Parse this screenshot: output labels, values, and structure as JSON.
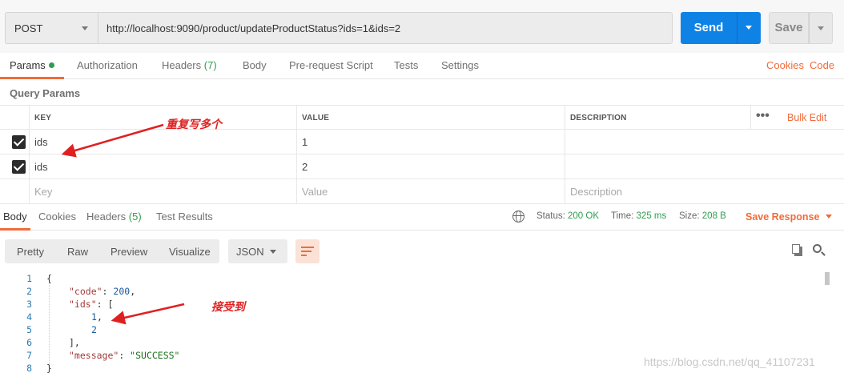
{
  "request": {
    "method": "POST",
    "url": "http://localhost:9090/product/updateProductStatus?ids=1&ids=2",
    "send_label": "Send",
    "save_label": "Save"
  },
  "request_tabs": {
    "params": "Params",
    "authorization": "Authorization",
    "headers": "Headers",
    "headers_count": "(7)",
    "body": "Body",
    "prerequest": "Pre-request Script",
    "tests": "Tests",
    "settings": "Settings",
    "cookies": "Cookies",
    "code": "Code"
  },
  "query_params": {
    "title": "Query Params",
    "columns": {
      "key": "KEY",
      "value": "VALUE",
      "description": "DESCRIPTION"
    },
    "bulk_edit": "Bulk Edit",
    "rows": [
      {
        "key": "ids",
        "value": "1"
      },
      {
        "key": "ids",
        "value": "2"
      }
    ],
    "placeholders": {
      "key": "Key",
      "value": "Value",
      "description": "Description"
    }
  },
  "response_tabs": {
    "body": "Body",
    "cookies": "Cookies",
    "headers": "Headers",
    "headers_count": "(5)",
    "test_results": "Test Results"
  },
  "response_status": {
    "status_label": "Status:",
    "status_value": "200 OK",
    "time_label": "Time:",
    "time_value": "325 ms",
    "size_label": "Size:",
    "size_value": "208 B",
    "save_response": "Save Response"
  },
  "viewer": {
    "pretty": "Pretty",
    "raw": "Raw",
    "preview": "Preview",
    "visualize": "Visualize",
    "format": "JSON"
  },
  "code": {
    "line_numbers": [
      "1",
      "2",
      "3",
      "4",
      "5",
      "6",
      "7",
      "8"
    ],
    "open_brace": "{",
    "code_key": "\"code\"",
    "code_val": "200",
    "ids_key": "\"ids\"",
    "ids_open": "[",
    "id1": "1",
    "id2": "2",
    "ids_close": "],",
    "message_key": "\"message\"",
    "message_val": "\"SUCCESS\"",
    "close_brace": "}"
  },
  "annotations": {
    "repeat": "重复写多个",
    "received": "接受到"
  },
  "watermark": "https://blog.csdn.net/qq_41107231",
  "colors": {
    "send": "#0f82e6",
    "accent": "#f26b3a",
    "ok": "#2e9e4e",
    "annotation": "#e02020"
  }
}
